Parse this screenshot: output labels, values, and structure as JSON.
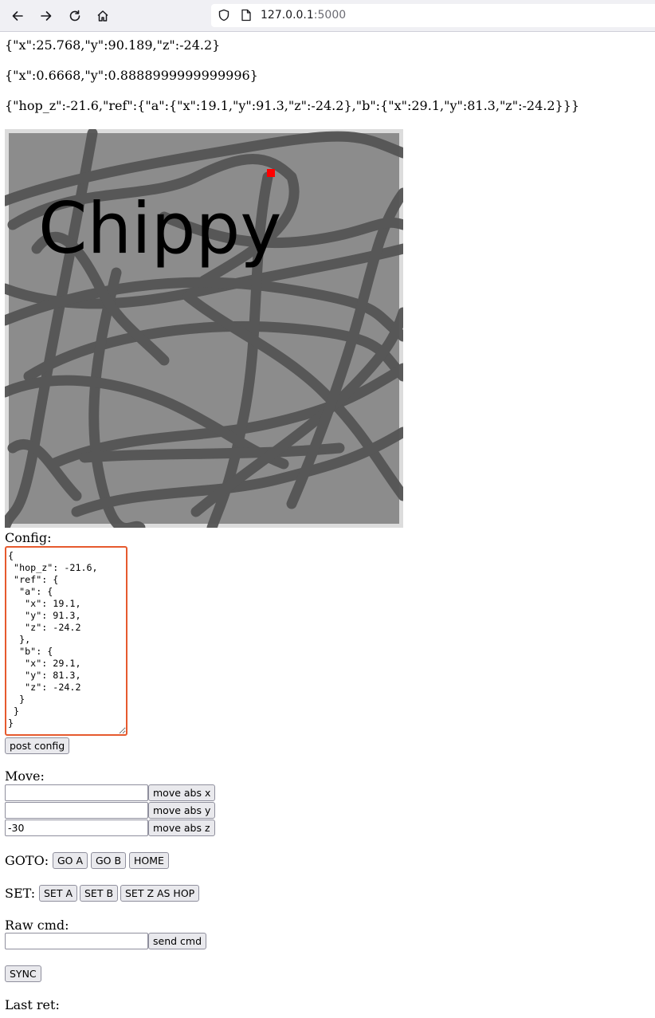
{
  "browser": {
    "url_host": "127.0.0.1",
    "url_port": ":5000"
  },
  "status": {
    "position": "{\"x\":25.768,\"y\":90.189,\"z\":-24.2}",
    "normalized": "{\"x\":0.6668,\"y\":0.8888999999999996}",
    "config_json": "{\"hop_z\":-21.6,\"ref\":{\"a\":{\"x\":19.1,\"y\":91.3,\"z\":-24.2},\"b\":{\"x\":29.1,\"y\":81.3,\"z\":-24.2}}}"
  },
  "canvas": {
    "title": "Chippy",
    "marker_color": "#ff0000",
    "background_color": "#8c8c8c",
    "stroke_color": "#555555"
  },
  "config": {
    "label": "Config:",
    "text": "{\n \"hop_z\": -21.6,\n \"ref\": {\n  \"a\": {\n   \"x\": 19.1,\n   \"y\": 91.3,\n   \"z\": -24.2\n  },\n  \"b\": {\n   \"x\": 29.1,\n   \"y\": 81.3,\n   \"z\": -24.2\n  }\n }\n}",
    "post_button": "post config"
  },
  "move": {
    "label": "Move:",
    "x_value": "",
    "y_value": "",
    "z_value": "-30",
    "x_button": "move abs x",
    "y_button": "move abs y",
    "z_button": "move abs z"
  },
  "goto": {
    "label": "GOTO:",
    "go_a": "GO A",
    "go_b": "GO B",
    "home": "HOME"
  },
  "set": {
    "label": "SET:",
    "set_a": "SET A",
    "set_b": "SET B",
    "set_z_hop": "SET Z AS HOP"
  },
  "raw": {
    "label": "Raw cmd:",
    "value": "",
    "send_button": "send cmd"
  },
  "sync_button": "SYNC",
  "last_ret": {
    "label": "Last ret:"
  }
}
